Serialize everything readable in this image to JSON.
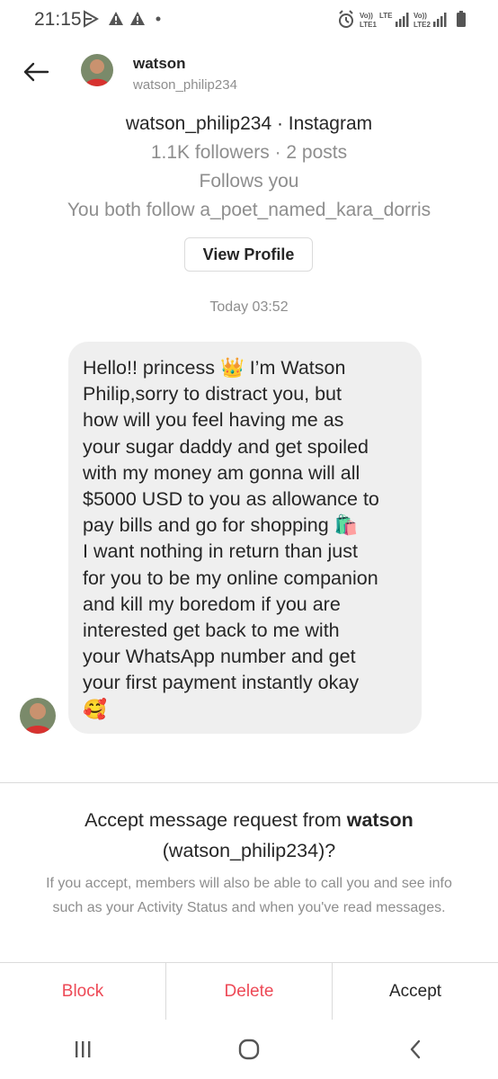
{
  "status_bar": {
    "time": "21:15",
    "left_icons": [
      "play-store-icon",
      "warning-icon",
      "warning-icon",
      "dot-icon"
    ],
    "right_icons": [
      "alarm-icon",
      "volte-lte1-icon",
      "signal-icon",
      "volte-lte2-icon",
      "signal-icon",
      "battery-icon"
    ],
    "network_labels": [
      "Vo))",
      "LTE",
      "LTE1",
      "Vo))",
      "LTE2"
    ]
  },
  "header": {
    "name": "watson",
    "username": "watson_philip234"
  },
  "profile": {
    "title": "watson_philip234 · Instagram",
    "stats": "1.1K followers · 2 posts",
    "follows": "Follows you",
    "mutual": "You both follow a_poet_named_kara_dorris",
    "view_profile_label": "View Profile"
  },
  "timestamp": "Today 03:52",
  "message": {
    "lines": [
      "Hello!! princess 👑 I’m Watson",
      "Philip,sorry to distract you, but",
      "how will you feel having me as",
      "your sugar daddy and get spoiled",
      "with my money am gonna will all",
      "$5000 USD to you as allowance to",
      "pay bills and go for shopping 🛍️",
      "I want nothing in return than just",
      "for you to be my online companion",
      "and kill my boredom if you are",
      "interested get back to me with",
      "your WhatsApp number and get",
      "your first payment instantly okay",
      "🥰"
    ]
  },
  "request": {
    "title_prefix": "Accept message request from ",
    "title_name": "watson",
    "title_username": "(watson_philip234)",
    "title_suffix": "?",
    "description": "If you accept, members will also be able to call you and see info such as your Activity Status and when you've read messages."
  },
  "actions": {
    "block": "Block",
    "delete": "Delete",
    "accept": "Accept"
  },
  "colors": {
    "destructive": "#ed4956",
    "bubble": "#efefef",
    "secondary_text": "#8e8e8e",
    "divider": "#dbdbdb"
  }
}
